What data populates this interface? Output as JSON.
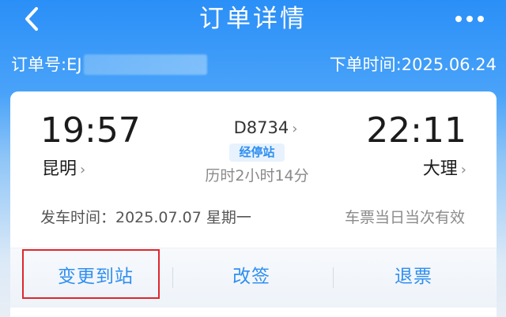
{
  "header": {
    "title": "订单详情",
    "back_icon": "chevron-left-icon",
    "more_icon": "more-dots-icon"
  },
  "order": {
    "number_label": "订单号:EJ",
    "time_label": "下单时间:2025.06.24"
  },
  "trip": {
    "departure_time": "19:57",
    "arrival_time": "22:11",
    "departure_station": "昆明",
    "arrival_station": "大理",
    "train_no": "D8734",
    "stop_badge": "经停站",
    "duration": "历时2小时14分",
    "depart_date": "发车时间：2025.07.07 星期一",
    "validity": "车票当日当次有效",
    "chevron": "›"
  },
  "actions": {
    "change_station": "变更到站",
    "reschedule": "改签",
    "refund": "退票"
  },
  "colors": {
    "accent": "#2f8ff0",
    "highlight_border": "#e0262c",
    "header_blue": "#2a8ff7"
  }
}
